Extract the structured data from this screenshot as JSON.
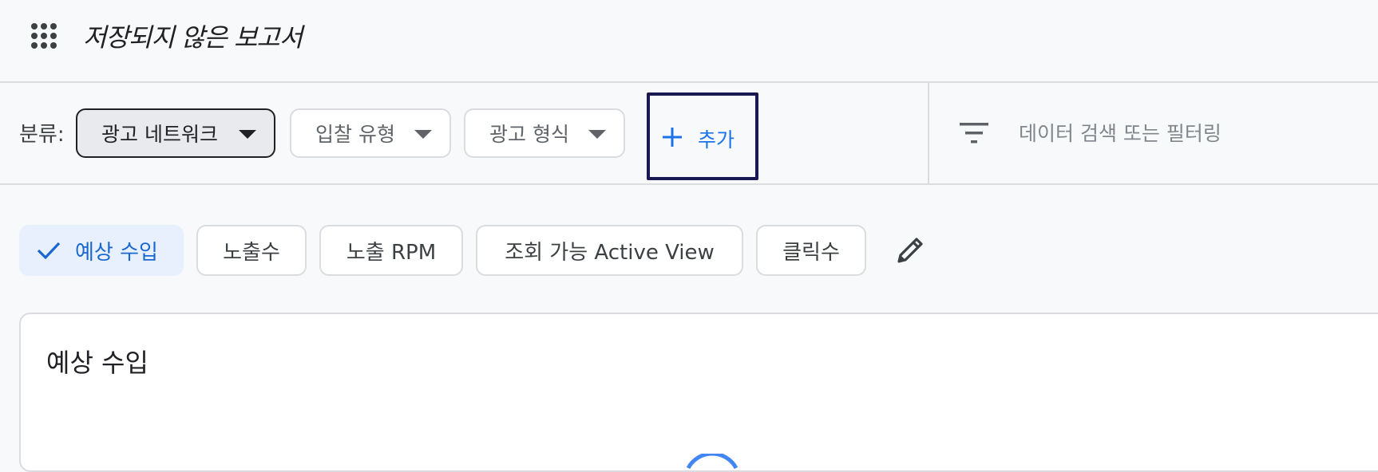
{
  "header": {
    "apps_icon": "apps-grid-icon",
    "report_title": "저장되지 않은 보고서"
  },
  "toolbar": {
    "breakdown_label": "분류:",
    "dimensions": [
      {
        "label": "광고 네트워크",
        "selected": true
      },
      {
        "label": "입찰 유형",
        "selected": false
      },
      {
        "label": "광고 형식",
        "selected": false
      }
    ],
    "add_label": "추가",
    "filter_icon": "filter-list-icon",
    "filter_placeholder": "데이터 검색 또는 필터링"
  },
  "metrics": {
    "chips": [
      {
        "label": "예상 수입",
        "selected": true
      },
      {
        "label": "노출수",
        "selected": false
      },
      {
        "label": "노출 RPM",
        "selected": false
      },
      {
        "label": "조회 가능 Active View",
        "selected": false
      },
      {
        "label": "클릭수",
        "selected": false
      }
    ],
    "edit_icon": "pencil-edit-icon"
  },
  "chart_card": {
    "title": "예상 수입",
    "status": "loading"
  },
  "colors": {
    "accent": "#1a73e8",
    "selected_metric_bg": "#e8f0fe",
    "selected_dimension_bg": "#e8eaed",
    "highlight_border": "#1a1851",
    "divider": "#dadce0"
  }
}
